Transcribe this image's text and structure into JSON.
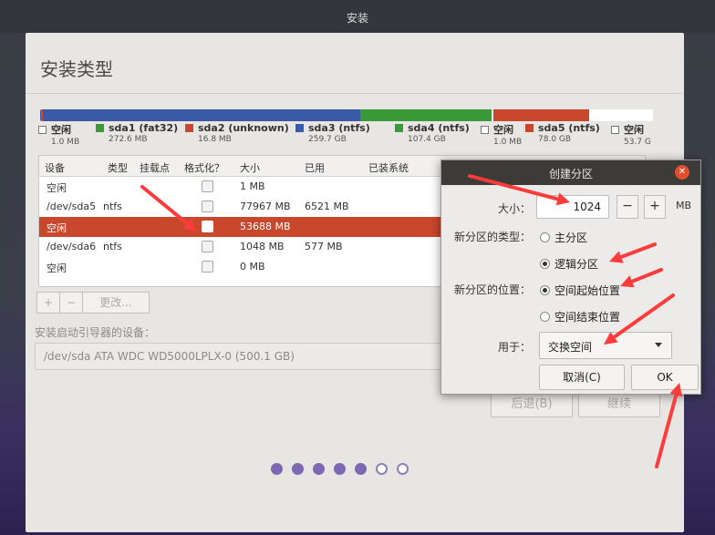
{
  "topbar": {
    "title": "安装"
  },
  "page": {
    "title": "安装类型"
  },
  "partition_bar": [
    {
      "color": "#3b5aa6",
      "percent": 0.2
    },
    {
      "color": "#3a9a3a",
      "percent": 0.1
    },
    {
      "color": "#c9472d",
      "percent": 0.1
    },
    {
      "color": "#3b5aa6",
      "percent": 51.9
    },
    {
      "color": "#3a9a3a",
      "percent": 21.5
    },
    {
      "color": "#ffffff",
      "percent": 0.2
    },
    {
      "color": "#c9472d",
      "percent": 15.6
    },
    {
      "color": "#ffffff",
      "percent": 10.5
    }
  ],
  "legend": [
    {
      "label": "空闲",
      "size": "1.0 MB",
      "color": "#ffffff",
      "free": true
    },
    {
      "label": "sda1 (fat32)",
      "size": "272.6 MB",
      "color": "#3a9a3a",
      "free": false
    },
    {
      "label": "sda2 (unknown)",
      "size": "16.8 MB",
      "color": "#c9472d",
      "free": false
    },
    {
      "label": "sda3 (ntfs)",
      "size": "259.7 GB",
      "color": "#3b5aa6",
      "free": false
    },
    {
      "label": "sda4 (ntfs)",
      "size": "107.4 GB",
      "color": "#3a9a3a",
      "free": false
    },
    {
      "label": "空闲",
      "size": "1.0 MB",
      "color": "#ffffff",
      "free": true
    },
    {
      "label": "sda5 (ntfs)",
      "size": "78.0 GB",
      "color": "#c9472d",
      "free": false
    },
    {
      "label": "空闲",
      "size": "53.7 G",
      "color": "#ffffff",
      "free": true
    }
  ],
  "table": {
    "headers": [
      "设备",
      "类型",
      "挂载点",
      "格式化？",
      "大小",
      "已用",
      "已装系统"
    ],
    "rows": [
      {
        "device": "空闲",
        "type": "",
        "mount": "",
        "size": "1 MB",
        "used": "",
        "system": "",
        "selected": false
      },
      {
        "device": "/dev/sda5",
        "type": "ntfs",
        "mount": "",
        "size": "77967 MB",
        "used": "6521 MB",
        "system": "",
        "selected": false
      },
      {
        "device": "空闲",
        "type": "",
        "mount": "",
        "size": "53688 MB",
        "used": "",
        "system": "",
        "selected": true
      },
      {
        "device": "/dev/sda6",
        "type": "ntfs",
        "mount": "",
        "size": "1048 MB",
        "used": "577 MB",
        "system": "",
        "selected": false
      },
      {
        "device": "空闲",
        "type": "",
        "mount": "",
        "size": "0 MB",
        "used": "",
        "system": "",
        "selected": false
      }
    ]
  },
  "table_buttons": {
    "add": "+",
    "remove": "−",
    "change": "更改..."
  },
  "boot": {
    "label": "安装启动引导器的设备：",
    "value": "/dev/sda   ATA WDC WD5000LPLX-0 (500.1 GB)"
  },
  "nav": {
    "back": "后退(B)",
    "continue": "继续"
  },
  "progress_dots": {
    "total": 7,
    "filled": 5
  },
  "dialog": {
    "title": "创建分区",
    "size_label": "大小：",
    "size_value": "1024",
    "minus": "−",
    "plus": "+",
    "unit": "MB",
    "type_label": "新分区的类型：",
    "type_primary": "主分区",
    "type_logical": "逻辑分区",
    "type_selected": "logical",
    "location_label": "新分区的位置：",
    "location_start": "空间起始位置",
    "location_end": "空间结束位置",
    "location_selected": "start",
    "use_label": "用于：",
    "use_value": "交换空间",
    "cancel": "取消(C)",
    "ok": "OK"
  },
  "annotation_color": "#ff3b3b"
}
